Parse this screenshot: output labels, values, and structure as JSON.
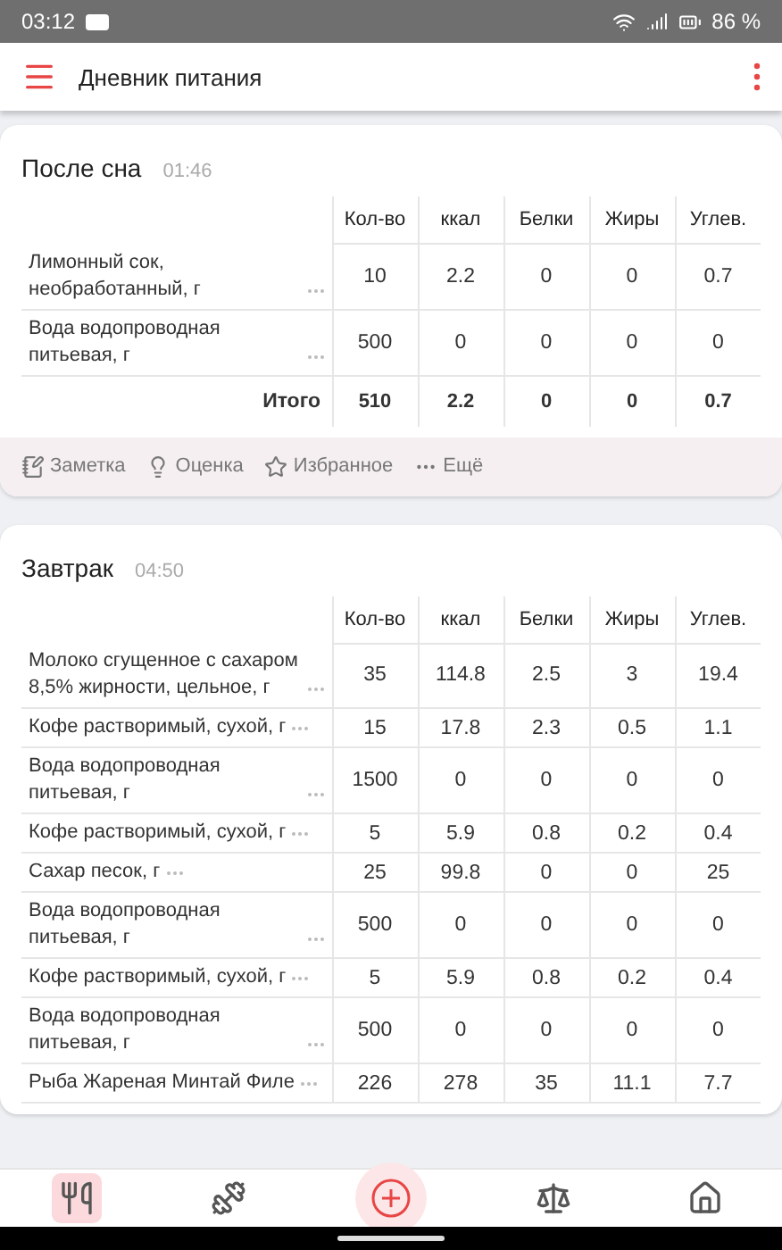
{
  "status_bar": {
    "time": "03:12",
    "battery": "86 %"
  },
  "app_bar": {
    "title": "Дневник питания"
  },
  "meals": [
    {
      "title": "После сна",
      "time": "01:46",
      "columns": [
        "Кол-во",
        "ккал",
        "Белки",
        "Жиры",
        "Углев."
      ],
      "rows": [
        {
          "name": "Лимонный сок, необработанный, г",
          "values": [
            "10",
            "2.2",
            "0",
            "0",
            "0.7"
          ]
        },
        {
          "name": "Вода водопроводная питьевая, г",
          "values": [
            "500",
            "0",
            "0",
            "0",
            "0"
          ]
        }
      ],
      "total": {
        "label": "Итого",
        "values": [
          "510",
          "2.2",
          "0",
          "0",
          "0.7"
        ]
      },
      "actions": [
        {
          "kind": "note",
          "label": "Заметка"
        },
        {
          "kind": "rating",
          "label": "Оценка"
        },
        {
          "kind": "favorite",
          "label": "Избранное"
        },
        {
          "kind": "more",
          "label": "Ещё"
        }
      ]
    },
    {
      "title": "Завтрак",
      "time": "04:50",
      "columns": [
        "Кол-во",
        "ккал",
        "Белки",
        "Жиры",
        "Углев."
      ],
      "rows": [
        {
          "name": "Молоко сгущенное с сахаром 8,5% жирности, цельное, г",
          "values": [
            "35",
            "114.8",
            "2.5",
            "3",
            "19.4"
          ]
        },
        {
          "name": "Кофе растворимый, сухой, г",
          "values": [
            "15",
            "17.8",
            "2.3",
            "0.5",
            "1.1"
          ]
        },
        {
          "name": "Вода водопроводная питьевая, г",
          "values": [
            "1500",
            "0",
            "0",
            "0",
            "0"
          ]
        },
        {
          "name": "Кофе растворимый, сухой, г",
          "values": [
            "5",
            "5.9",
            "0.8",
            "0.2",
            "0.4"
          ]
        },
        {
          "name": "Сахар песок, г",
          "values": [
            "25",
            "99.8",
            "0",
            "0",
            "25"
          ]
        },
        {
          "name": "Вода водопроводная питьевая, г",
          "values": [
            "500",
            "0",
            "0",
            "0",
            "0"
          ]
        },
        {
          "name": "Кофе растворимый, сухой, г",
          "values": [
            "5",
            "5.9",
            "0.8",
            "0.2",
            "0.4"
          ]
        },
        {
          "name": "Вода водопроводная питьевая, г",
          "values": [
            "500",
            "0",
            "0",
            "0",
            "0"
          ]
        },
        {
          "name": "Рыба Жареная Минтай Филе",
          "values": [
            "226",
            "278",
            "35",
            "11.1",
            "7.7"
          ]
        }
      ]
    }
  ],
  "bottom_nav": [
    {
      "kind": "diary",
      "selected": true
    },
    {
      "kind": "exercise",
      "selected": false
    },
    {
      "kind": "add",
      "selected": false
    },
    {
      "kind": "scale",
      "selected": false
    },
    {
      "kind": "home",
      "selected": false
    }
  ]
}
